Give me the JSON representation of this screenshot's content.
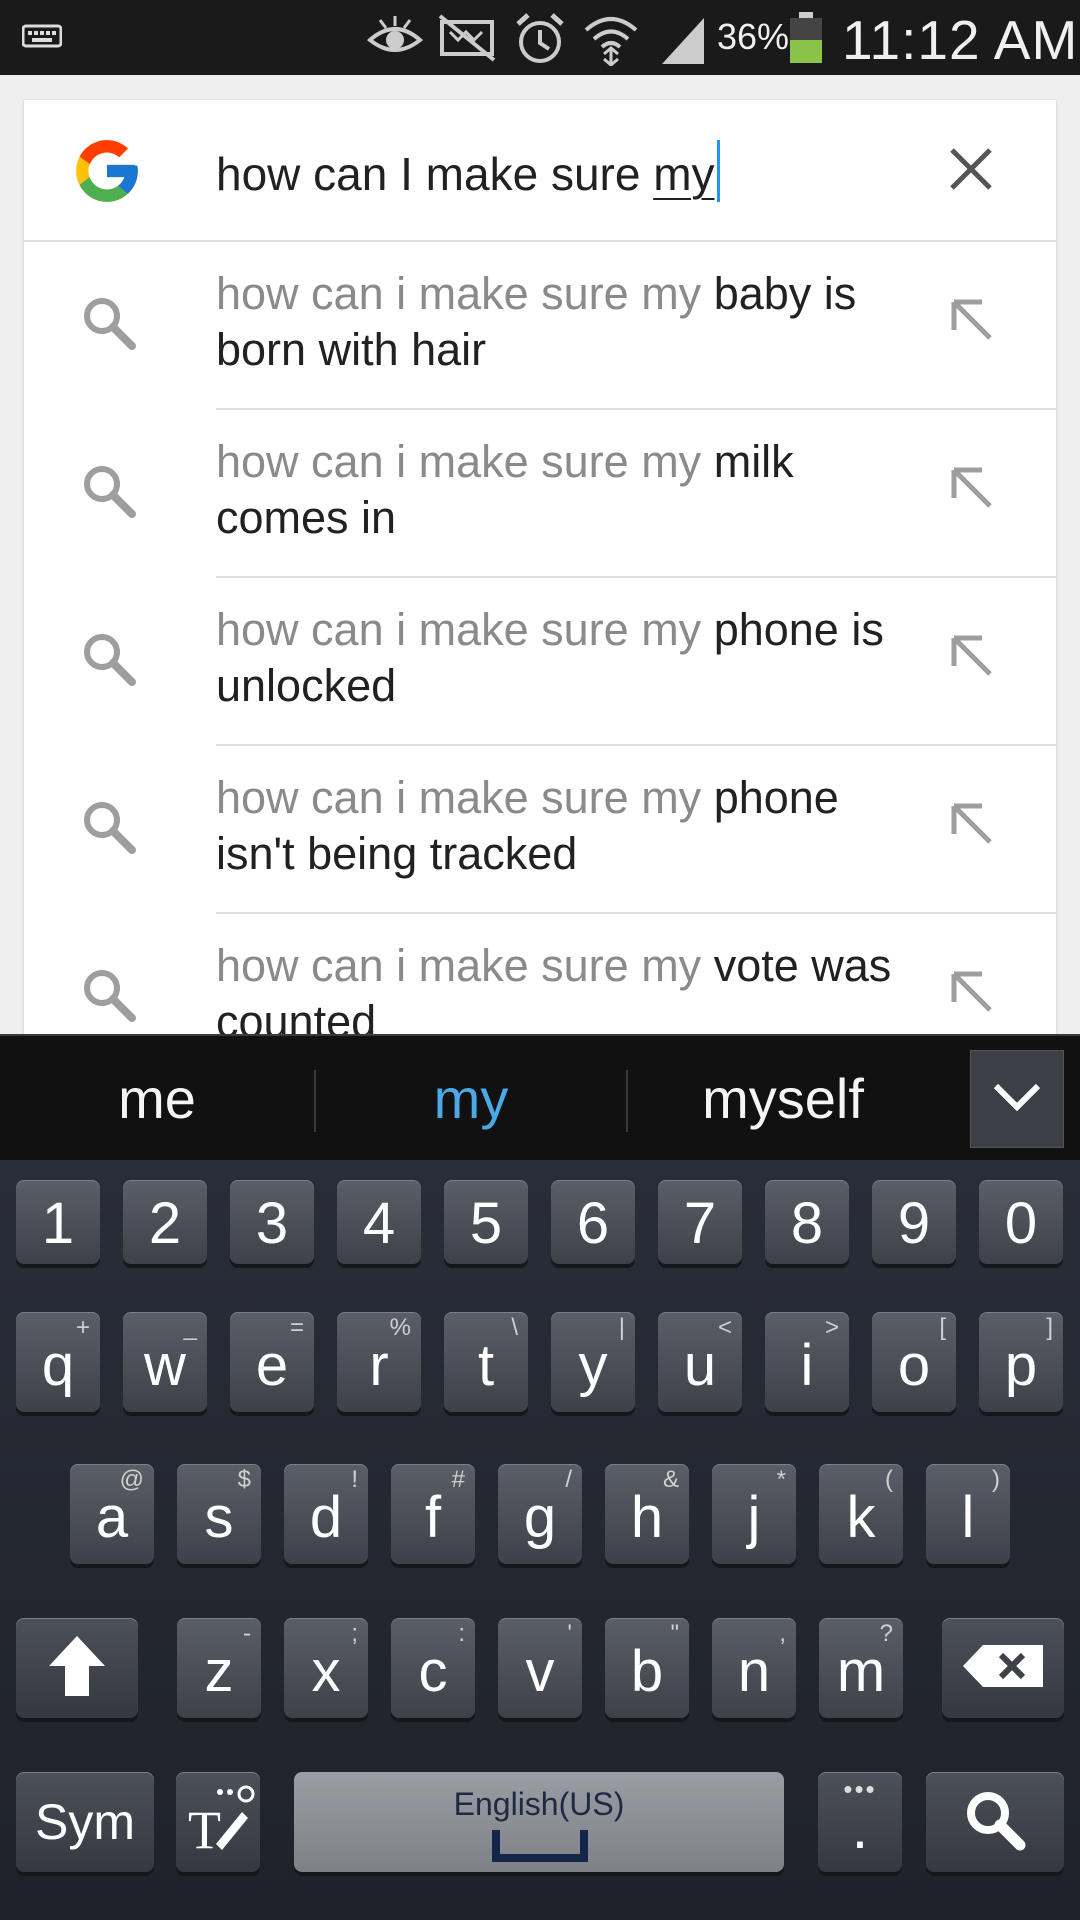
{
  "status_bar": {
    "battery_percent": "36%",
    "time": "11:12 AM",
    "icons": [
      "keyboard-icon",
      "eye-icon",
      "no-sim-icon",
      "alarm-icon",
      "wifi-icon",
      "signal-icon",
      "battery-icon"
    ],
    "battery_color": "#8bc34a"
  },
  "search": {
    "query_prefix": "how can I make sure ",
    "query_last_word": "my",
    "caret_color": "#2196f3",
    "clear_icon": "close-icon"
  },
  "suggestions": [
    {
      "prefix": "how can i make sure my",
      "completion": "baby is born with hair"
    },
    {
      "prefix": "how can i make sure my",
      "completion": "milk comes in"
    },
    {
      "prefix": "how can i make sure my",
      "completion": "phone is unlocked"
    },
    {
      "prefix": "how can i make sure my",
      "completion": "phone isn't being tracked"
    },
    {
      "prefix": "how can i make sure my",
      "completion": "vote was counted"
    }
  ],
  "keyboard": {
    "predictions": [
      "me",
      "my",
      "myself"
    ],
    "active_prediction_color": "#4aa9e6",
    "number_row": [
      "1",
      "2",
      "3",
      "4",
      "5",
      "6",
      "7",
      "8",
      "9",
      "0"
    ],
    "row1": [
      {
        "key": "q",
        "alt": "+"
      },
      {
        "key": "w",
        "alt": "_"
      },
      {
        "key": "e",
        "alt": "="
      },
      {
        "key": "r",
        "alt": "%"
      },
      {
        "key": "t",
        "alt": "\\"
      },
      {
        "key": "y",
        "alt": "|"
      },
      {
        "key": "u",
        "alt": "<"
      },
      {
        "key": "i",
        "alt": ">"
      },
      {
        "key": "o",
        "alt": "["
      },
      {
        "key": "p",
        "alt": "]"
      }
    ],
    "row2": [
      {
        "key": "a",
        "alt": "@"
      },
      {
        "key": "s",
        "alt": "$"
      },
      {
        "key": "d",
        "alt": "!"
      },
      {
        "key": "f",
        "alt": "#"
      },
      {
        "key": "g",
        "alt": "/"
      },
      {
        "key": "h",
        "alt": "&"
      },
      {
        "key": "j",
        "alt": "*"
      },
      {
        "key": "k",
        "alt": "("
      },
      {
        "key": "l",
        "alt": ")"
      }
    ],
    "row3": [
      {
        "key": "z",
        "alt": "-"
      },
      {
        "key": "x",
        "alt": ";"
      },
      {
        "key": "c",
        "alt": ":"
      },
      {
        "key": "v",
        "alt": "'"
      },
      {
        "key": "b",
        "alt": "\""
      },
      {
        "key": "n",
        "alt": ","
      },
      {
        "key": "m",
        "alt": "?"
      }
    ],
    "sym_label": "Sym",
    "language_label": "English(US)",
    "period_label": "."
  }
}
